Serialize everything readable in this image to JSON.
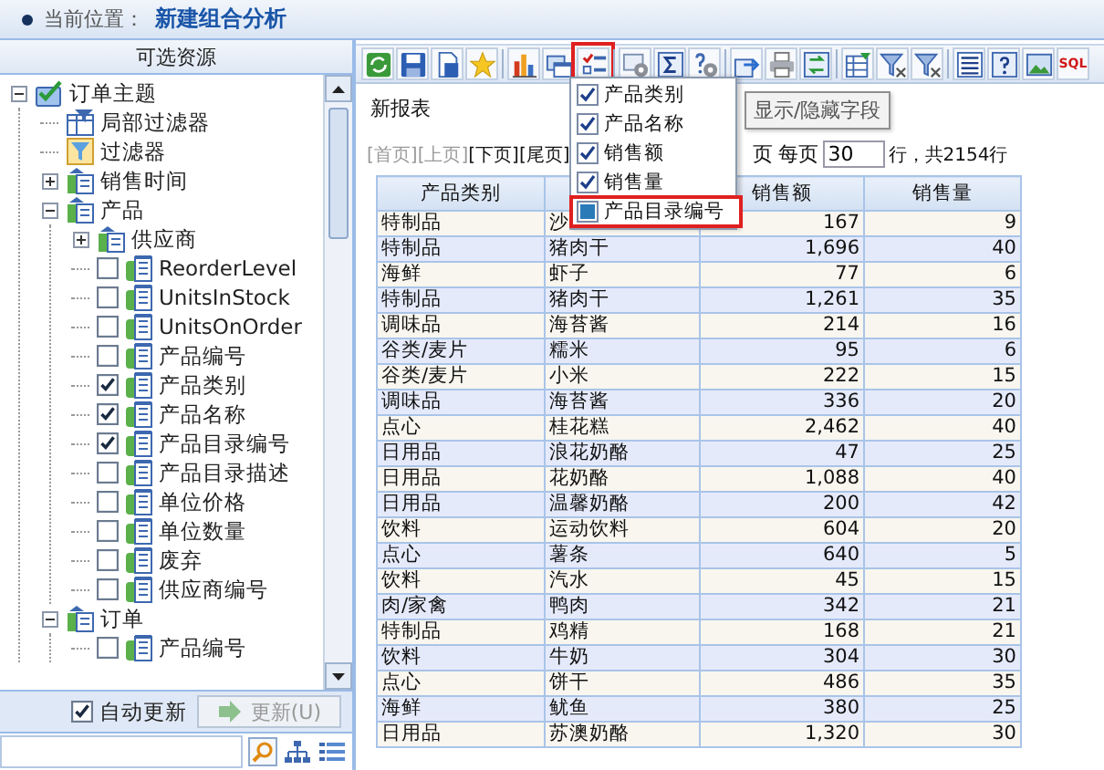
{
  "location": {
    "label": "当前位置：",
    "title": "新建组合分析"
  },
  "resources": {
    "title": "可选资源",
    "tree": [
      {
        "kind": "theme",
        "label": "订单主题",
        "expanded": true,
        "children": [
          {
            "kind": "local-filter",
            "label": "局部过滤器"
          },
          {
            "kind": "filter",
            "label": "过滤器"
          },
          {
            "kind": "group",
            "label": "销售时间",
            "expanded": false
          },
          {
            "kind": "group",
            "label": "产品",
            "expanded": true,
            "children": [
              {
                "kind": "group",
                "label": "供应商",
                "expanded": false
              },
              {
                "kind": "field",
                "label": "ReorderLevel",
                "checked": false
              },
              {
                "kind": "field",
                "label": "UnitsInStock",
                "checked": false
              },
              {
                "kind": "field",
                "label": "UnitsOnOrder",
                "checked": false
              },
              {
                "kind": "field",
                "label": "产品编号",
                "checked": false
              },
              {
                "kind": "field",
                "label": "产品类别",
                "checked": true
              },
              {
                "kind": "field",
                "label": "产品名称",
                "checked": true
              },
              {
                "kind": "field",
                "label": "产品目录编号",
                "checked": true
              },
              {
                "kind": "field",
                "label": "产品目录描述",
                "checked": false
              },
              {
                "kind": "field",
                "label": "单位价格",
                "checked": false
              },
              {
                "kind": "field",
                "label": "单位数量",
                "checked": false
              },
              {
                "kind": "field",
                "label": "废弃",
                "checked": false
              },
              {
                "kind": "field",
                "label": "供应商编号",
                "checked": false
              }
            ]
          },
          {
            "kind": "group",
            "label": "订单",
            "expanded": true,
            "children": [
              {
                "kind": "field",
                "label": "产品编号",
                "checked": false
              }
            ]
          }
        ]
      }
    ],
    "auto_update": {
      "label": "自动更新",
      "checked": true
    },
    "update_button": {
      "label": "更新(U)",
      "disabled": true
    }
  },
  "toolbar": [
    {
      "kind": "refresh",
      "highlighted": false
    },
    {
      "kind": "save",
      "highlighted": false
    },
    {
      "kind": "document",
      "highlighted": false
    },
    {
      "kind": "star",
      "highlighted": false
    },
    {
      "kind": "separator"
    },
    {
      "kind": "bar-chart",
      "highlighted": false
    },
    {
      "kind": "window",
      "highlighted": false
    },
    {
      "kind": "checklist",
      "highlighted": true
    },
    {
      "kind": "separator"
    },
    {
      "kind": "gear",
      "highlighted": false
    },
    {
      "kind": "sigma",
      "highlighted": false
    },
    {
      "kind": "question-gear",
      "highlighted": false
    },
    {
      "kind": "separator"
    },
    {
      "kind": "export",
      "highlighted": false
    },
    {
      "kind": "printer",
      "highlighted": false
    },
    {
      "kind": "arrows",
      "highlighted": false
    },
    {
      "kind": "separator"
    },
    {
      "kind": "table",
      "highlighted": false
    },
    {
      "kind": "funnel",
      "highlighted": false
    },
    {
      "kind": "funnel",
      "highlighted": false
    },
    {
      "kind": "separator"
    },
    {
      "kind": "list",
      "highlighted": false
    },
    {
      "kind": "help",
      "highlighted": false
    },
    {
      "kind": "image",
      "highlighted": false
    },
    {
      "kind": "sql",
      "label": "SQL",
      "highlighted": false
    }
  ],
  "report": {
    "title": "新报表",
    "pager": {
      "links": [
        {
          "label": "[首页]",
          "disabled": true
        },
        {
          "label": "[上页]",
          "disabled": true
        },
        {
          "label": "[下页]",
          "disabled": false
        },
        {
          "label": "[尾页]",
          "disabled": false
        }
      ],
      "after": "页 每页",
      "per_page": "30",
      "total": "行，共2154行"
    },
    "columns": [
      {
        "kind": "text",
        "label": "产品类别"
      },
      {
        "kind": "text"
      },
      {
        "kind": "number",
        "label": "销售额"
      },
      {
        "kind": "number",
        "label": "销售量"
      }
    ],
    "rows": [
      [
        "特制品",
        "沙",
        "167",
        "9"
      ],
      [
        "特制品",
        "猪肉干",
        "1,696",
        "40"
      ],
      [
        "海鲜",
        "虾子",
        "77",
        "6"
      ],
      [
        "特制品",
        "猪肉干",
        "1,261",
        "35"
      ],
      [
        "调味品",
        "海苔酱",
        "214",
        "16"
      ],
      [
        "谷类/麦片",
        "糯米",
        "95",
        "6"
      ],
      [
        "谷类/麦片",
        "小米",
        "222",
        "15"
      ],
      [
        "调味品",
        "海苔酱",
        "336",
        "20"
      ],
      [
        "点心",
        "桂花糕",
        "2,462",
        "40"
      ],
      [
        "日用品",
        "浪花奶酪",
        "47",
        "25"
      ],
      [
        "日用品",
        "花奶酪",
        "1,088",
        "40"
      ],
      [
        "日用品",
        "温馨奶酪",
        "200",
        "42"
      ],
      [
        "饮料",
        "运动饮料",
        "604",
        "20"
      ],
      [
        "点心",
        "薯条",
        "640",
        "5"
      ],
      [
        "饮料",
        "汽水",
        "45",
        "15"
      ],
      [
        "肉/家禽",
        "鸭肉",
        "342",
        "21"
      ],
      [
        "特制品",
        "鸡精",
        "168",
        "21"
      ],
      [
        "饮料",
        "牛奶",
        "304",
        "30"
      ],
      [
        "点心",
        "饼干",
        "486",
        "35"
      ],
      [
        "海鲜",
        "鱿鱼",
        "380",
        "25"
      ],
      [
        "日用品",
        "苏澳奶酪",
        "1,320",
        "30"
      ]
    ],
    "menu": {
      "items": [
        {
          "label": "产品类别",
          "checked": true,
          "highlighted": false
        },
        {
          "label": "产品名称",
          "checked": true,
          "highlighted": false
        },
        {
          "label": "销售额",
          "checked": true,
          "highlighted": false
        },
        {
          "label": "销售量",
          "checked": true,
          "highlighted": false
        },
        {
          "label": "产品目录编号",
          "checked": false,
          "highlighted": true
        }
      ],
      "tooltip": "显示/隐藏字段"
    }
  }
}
